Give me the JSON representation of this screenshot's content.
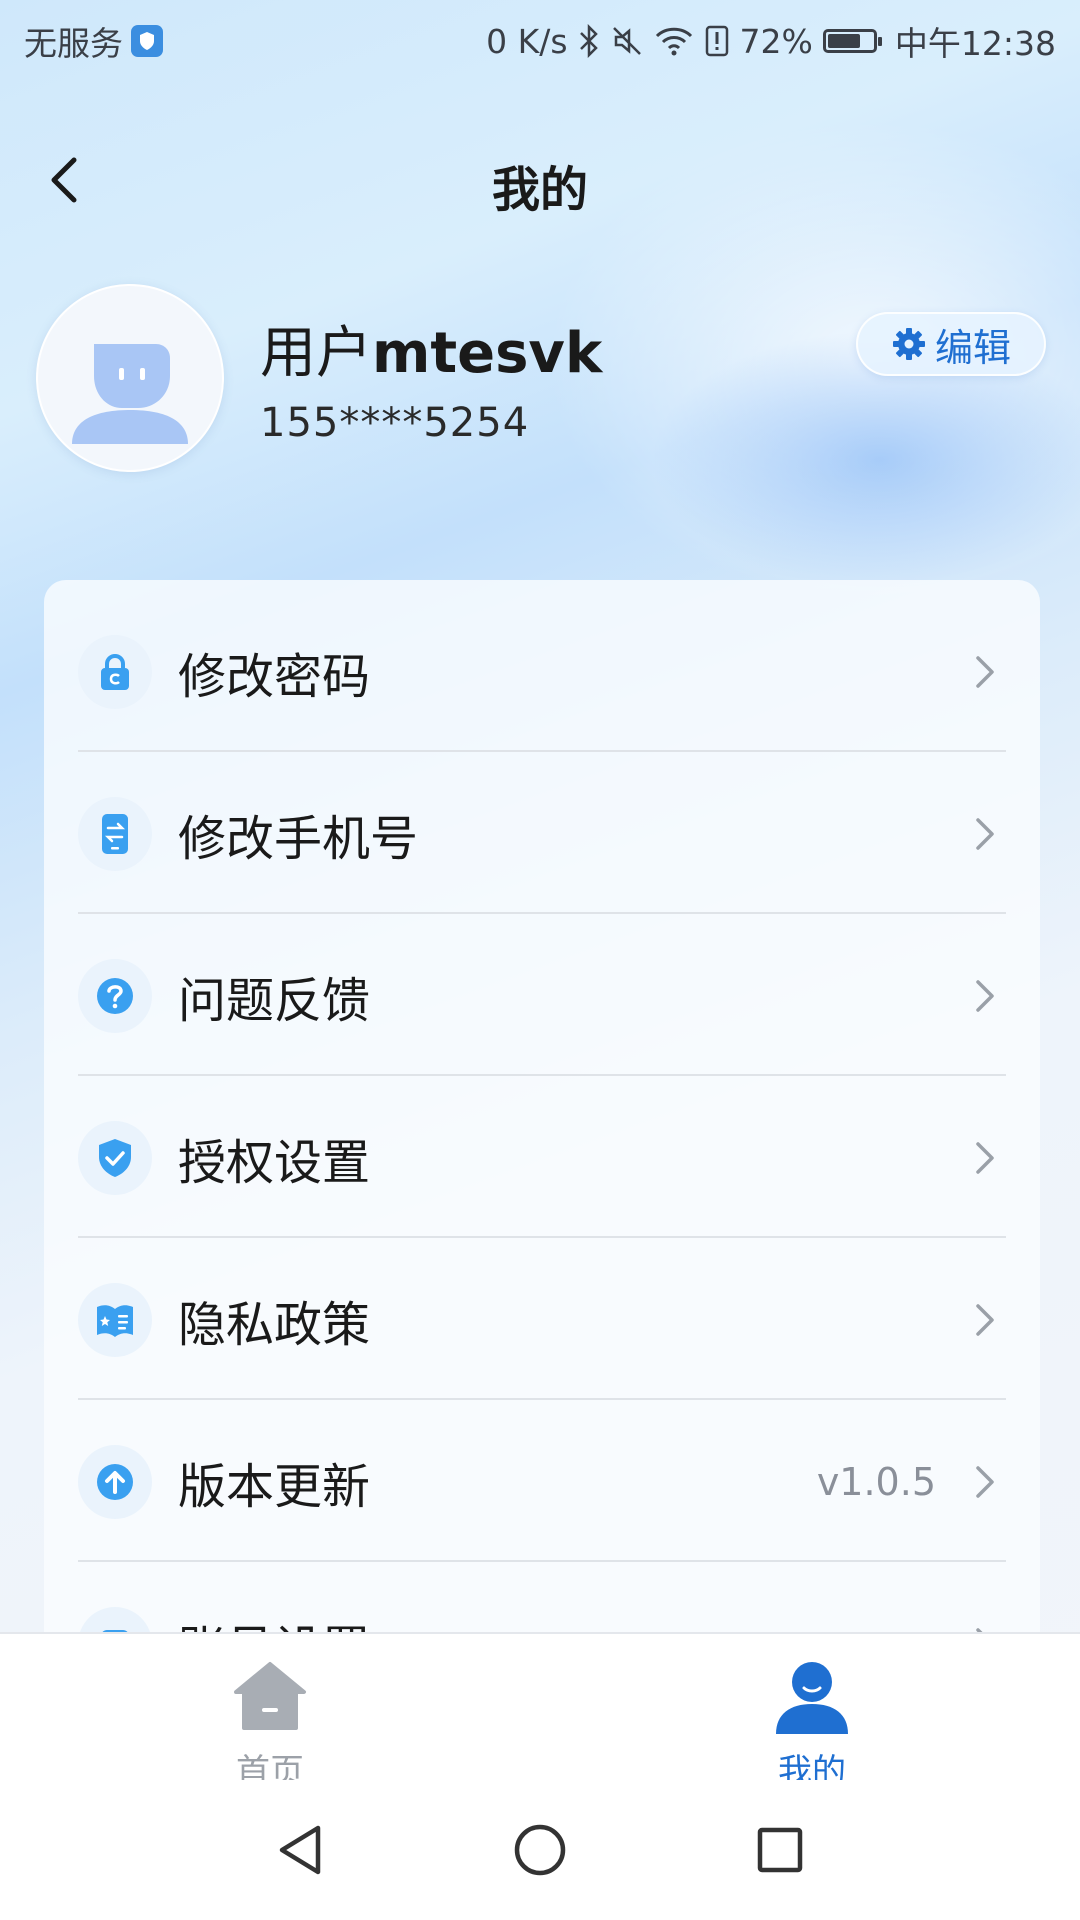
{
  "status_bar": {
    "carrier": "无服务",
    "net_speed": "0 K/s",
    "battery_percent": "72%",
    "battery_level": 0.72,
    "time": "中午12:38"
  },
  "header": {
    "title": "我的"
  },
  "profile": {
    "name_prefix": "用户",
    "name_suffix": "mtesvk",
    "phone": "155****5254",
    "edit_label": "编辑"
  },
  "menu": {
    "items": [
      {
        "label": "修改密码",
        "icon": "lock-icon",
        "value": ""
      },
      {
        "label": "修改手机号",
        "icon": "phone-swap-icon",
        "value": ""
      },
      {
        "label": "问题反馈",
        "icon": "question-icon",
        "value": ""
      },
      {
        "label": "授权设置",
        "icon": "shield-check-icon",
        "value": ""
      },
      {
        "label": "隐私政策",
        "icon": "privacy-book-icon",
        "value": ""
      },
      {
        "label": "版本更新",
        "icon": "upload-arrow-icon",
        "value": "v1.0.5"
      },
      {
        "label": "账号设置",
        "icon": "account-icon",
        "value": ""
      }
    ]
  },
  "tabs": [
    {
      "label": "首页",
      "icon": "home-icon",
      "active": false
    },
    {
      "label": "我的",
      "icon": "user-icon",
      "active": true
    }
  ],
  "colors": {
    "accent": "#1f6fd1",
    "icon_blue": "#3aa0f0",
    "inactive_tab": "#9ca1a8"
  },
  "system_nav": [
    "back",
    "home",
    "recents"
  ]
}
